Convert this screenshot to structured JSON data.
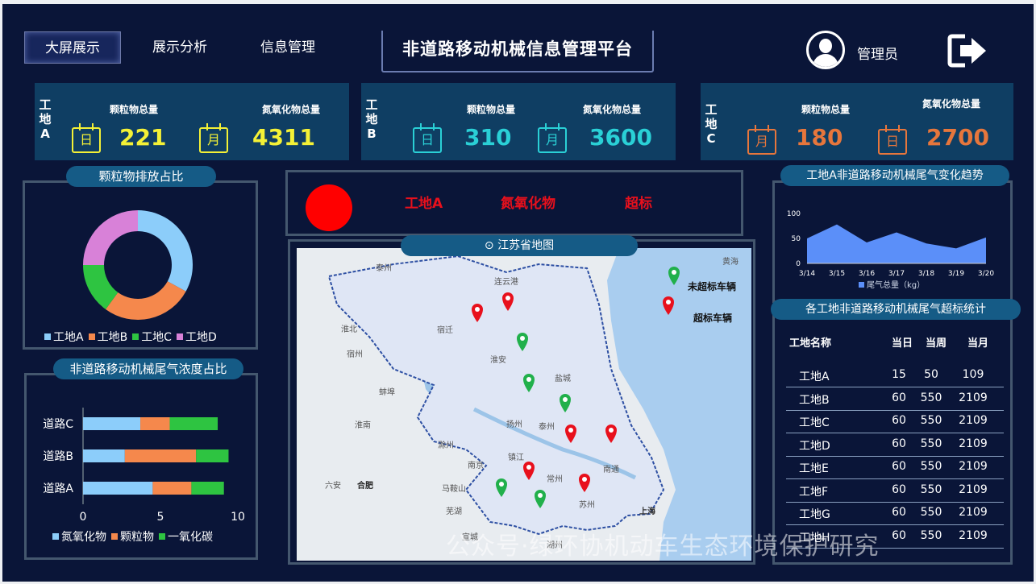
{
  "header": {
    "nav": [
      "大屏展示",
      "展示分析",
      "信息管理"
    ],
    "title": "非道路移动机械信息管理平台",
    "user": "管理员"
  },
  "cards": [
    {
      "site": [
        "工",
        "地",
        "A"
      ],
      "label1": "颗粒物总量",
      "cal1": "日",
      "value1": "221",
      "label2": "氮氧化物总量",
      "cal2": "月",
      "value2": "4311",
      "color": "#f4f136"
    },
    {
      "site": [
        "工",
        "地",
        "B"
      ],
      "label1": "颗粒物总量",
      "cal1": "日",
      "value1": "310",
      "label2": "氮氧化物总量",
      "cal2": "月",
      "value2": "3600",
      "color": "#2ad0d6"
    },
    {
      "site": [
        "工",
        "地",
        "C"
      ],
      "label1": "颗粒物总量",
      "cal1": "月",
      "value1": "180",
      "label2": "氮氧化物总量",
      "cal2": "日",
      "value2": "2700",
      "color": "#e6763c"
    }
  ],
  "donut": {
    "title": "颗粒物排放占比",
    "legend": [
      "工地A",
      "工地B",
      "工地C",
      "工地D"
    ],
    "colors": [
      "#8ccdfa",
      "#f5884c",
      "#2ec441",
      "#d881d8"
    ]
  },
  "bar": {
    "title": "非道路移动机械尾气浓度占比",
    "legend": [
      "氮氧化物",
      "颗粒物",
      "一氧化碳"
    ],
    "colors": [
      "#8ccdfa",
      "#f5884c",
      "#2ec441"
    ]
  },
  "alert": {
    "site": "工地A",
    "pollutant": "氮氧化物",
    "status": "超标"
  },
  "map": {
    "title": "江苏省地图",
    "legend_ok": "未超标车辆",
    "legend_bad": "超标车辆",
    "places": [
      "泰州",
      "连云港",
      "淮北",
      "宿迁",
      "宿州",
      "淮安",
      "盐城",
      "蚌埠",
      "淮南",
      "滁州",
      "扬州",
      "泰州",
      "南京",
      "镇江",
      "常州",
      "南通",
      "合肥",
      "六安",
      "马鞍山",
      "芜湖",
      "苏州",
      "上海",
      "宣城",
      "湖州",
      "黄海"
    ]
  },
  "trend": {
    "title": "工地A非道路移动机械尾气变化趋势",
    "legend": "尾气总量（kg）"
  },
  "table": {
    "title": "各工地非道路移动机械尾气超标统计",
    "headers": [
      "工地名称",
      "当日",
      "当周",
      "当月"
    ],
    "rows": [
      [
        "工地A",
        "15",
        "50",
        "109"
      ],
      [
        "工地B",
        "60",
        "550",
        "2109"
      ],
      [
        "工地C",
        "60",
        "550",
        "2109"
      ],
      [
        "工地D",
        "60",
        "550",
        "2109"
      ],
      [
        "工地E",
        "60",
        "550",
        "2109"
      ],
      [
        "工地F",
        "60",
        "550",
        "2109"
      ],
      [
        "工地G",
        "60",
        "550",
        "2109"
      ],
      [
        "工地H",
        "60",
        "550",
        "2109"
      ]
    ]
  },
  "watermark": "公众号·绿环协机动车生态环境保护研究",
  "chart_data": [
    {
      "type": "pie",
      "title": "颗粒物排放占比",
      "labels": [
        "工地A",
        "工地B",
        "工地C",
        "工地D"
      ],
      "values": [
        33,
        27,
        15,
        25
      ]
    },
    {
      "type": "bar",
      "title": "非道路移动机械尾气浓度占比",
      "orientation": "horizontal",
      "stacked": true,
      "categories": [
        "道路A",
        "道路B",
        "道路C"
      ],
      "series": [
        {
          "name": "氮氧化物",
          "values": [
            4.5,
            2.7,
            3.7
          ]
        },
        {
          "name": "颗粒物",
          "values": [
            2.5,
            4.6,
            1.9
          ]
        },
        {
          "name": "一氧化碳",
          "values": [
            2.1,
            2.1,
            3.1
          ]
        }
      ],
      "xlim": [
        0,
        10
      ],
      "xticks": [
        0,
        5,
        10
      ]
    },
    {
      "type": "area",
      "title": "工地A非道路移动机械尾气变化趋势",
      "x": [
        "3/14",
        "3/15",
        "3/16",
        "3/17",
        "3/18",
        "3/19",
        "3/20"
      ],
      "series": [
        {
          "name": "尾气总量（kg）",
          "values": [
            50,
            78,
            42,
            62,
            40,
            30,
            52
          ]
        }
      ],
      "ylim": [
        0,
        100
      ],
      "yticks": [
        0,
        50,
        100
      ]
    }
  ]
}
